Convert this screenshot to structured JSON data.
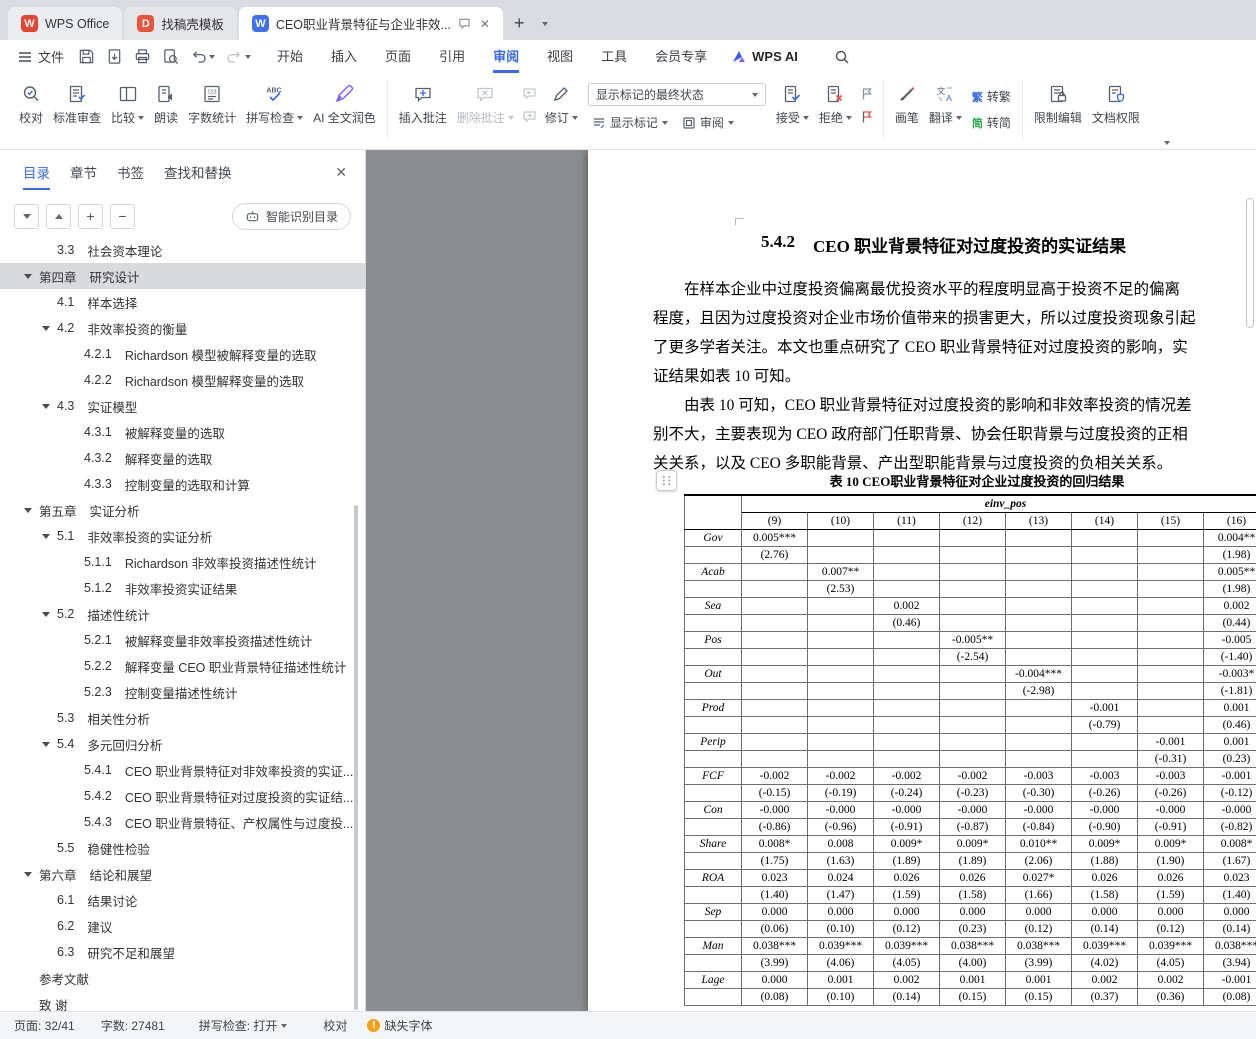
{
  "window": {
    "tabs": [
      {
        "title": "WPS Office"
      },
      {
        "title": "找稿壳模板"
      },
      {
        "title": "CEO职业背景特征与企业非效...",
        "active": true
      }
    ]
  },
  "menubar": {
    "file": "文件",
    "tabs": [
      "开始",
      "插入",
      "页面",
      "引用",
      "审阅",
      "视图",
      "工具",
      "会员专享"
    ],
    "active": "审阅",
    "wps_ai": "WPS AI"
  },
  "ribbon": {
    "proofread": "校对",
    "standard_review": "标准审查",
    "compare": "比较",
    "read_aloud": "朗读",
    "word_count": "字数统计",
    "spell_check": "拼写检查",
    "ai_polish": "AI 全文润色",
    "insert_comment": "插入批注",
    "delete_comment": "删除批注",
    "track_changes": "修订",
    "markup_state": "显示标记的最终状态",
    "show_markup": "显示标记",
    "review_mode": "审阅",
    "accept": "接受",
    "reject": "拒绝",
    "pen": "画笔",
    "translate": "翻译",
    "trad_char": "繁",
    "simp_char": "简",
    "to_trad": "转繁",
    "to_simp": "转简",
    "restrict_edit": "限制编辑",
    "doc_permission": "文档权限"
  },
  "sidebar": {
    "tabs": [
      "目录",
      "章节",
      "书签",
      "查找和替换"
    ],
    "active": "目录",
    "smart_toc": "智能识别目录",
    "toc": [
      {
        "num": "3.3",
        "title": "社会资本理论",
        "level": 2,
        "partial": true
      },
      {
        "num": "第四章",
        "title": "研究设计",
        "level": 1,
        "expand": true,
        "selected": true
      },
      {
        "num": "4.1",
        "title": "样本选择",
        "level": 2
      },
      {
        "num": "4.2",
        "title": "非效率投资的衡量",
        "level": 2,
        "expand": true
      },
      {
        "num": "4.2.1",
        "title": "Richardson 模型被解释变量的选取",
        "level": 3
      },
      {
        "num": "4.2.2",
        "title": "Richardson 模型解释变量的选取",
        "level": 3
      },
      {
        "num": "4.3",
        "title": "实证模型",
        "level": 2,
        "expand": true
      },
      {
        "num": "4.3.1",
        "title": "被解释变量的选取",
        "level": 3
      },
      {
        "num": "4.3.2",
        "title": "解释变量的选取",
        "level": 3
      },
      {
        "num": "4.3.3",
        "title": "控制变量的选取和计算",
        "level": 3
      },
      {
        "num": "第五章",
        "title": "实证分析",
        "level": 1,
        "expand": true
      },
      {
        "num": "5.1",
        "title": "非效率投资的实证分析",
        "level": 2,
        "expand": true
      },
      {
        "num": "5.1.1",
        "title": "Richardson 非效率投资描述性统计",
        "level": 3
      },
      {
        "num": "5.1.2",
        "title": "非效率投资实证结果",
        "level": 3
      },
      {
        "num": "5.2",
        "title": "描述性统计",
        "level": 2,
        "expand": true
      },
      {
        "num": "5.2.1",
        "title": "被解释变量非效率投资描述性统计",
        "level": 3
      },
      {
        "num": "5.2.2",
        "title": "解释变量 CEO 职业背景特征描述性统计",
        "level": 3
      },
      {
        "num": "5.2.3",
        "title": "控制变量描述性统计",
        "level": 3
      },
      {
        "num": "5.3",
        "title": "相关性分析",
        "level": 2
      },
      {
        "num": "5.4",
        "title": "多元回归分析",
        "level": 2,
        "expand": true
      },
      {
        "num": "5.4.1",
        "title": "CEO 职业背景特征对非效率投资的实证...",
        "level": 3
      },
      {
        "num": "5.4.2",
        "title": "CEO 职业背景特征对过度投资的实证结...",
        "level": 3
      },
      {
        "num": "5.4.3",
        "title": "CEO 职业背景特征、产权属性与过度投...",
        "level": 3
      },
      {
        "num": "5.5",
        "title": "稳健性检验",
        "level": 2
      },
      {
        "num": "第六章",
        "title": "结论和展望",
        "level": 1,
        "expand": true
      },
      {
        "num": "6.1",
        "title": "结果讨论",
        "level": 2
      },
      {
        "num": "6.2",
        "title": "建议",
        "level": 2
      },
      {
        "num": "6.3",
        "title": "研究不足和展望",
        "level": 2
      },
      {
        "num": "",
        "title": "参考文献",
        "level": 1
      },
      {
        "num": "",
        "title": "致 谢",
        "level": 1
      }
    ]
  },
  "document": {
    "heading_num": "5.4.2",
    "heading": "CEO 职业背景特征对过度投资的实证结果",
    "para1": [
      "在样本企业中过度投资偏离最优投资水平的程度明显高于投资不足的偏离",
      "程度，且因为过度投资对企业市场价值带来的损害更大，所以过度投资现象引起",
      "了更多学者关注。本文也重点研究了 CEO 职业背景特征对过度投资的影响，实",
      "证结果如表 10 可知。"
    ],
    "para2": [
      "由表 10 可知，CEO 职业背景特征对过度投资的影响和非效率投资的情况差",
      "别不大，主要表现为 CEO 政府部门任职背景、协会任职背景与过度投资的正相",
      "关关系，以及 CEO 多职能背景、产出型职能背景与过度投资的负相关关系。"
    ],
    "table": {
      "caption": "表 10  CEO职业背景特征对企业过度投资的回归结果",
      "group_header": "einv_pos",
      "col_headers": [
        "(9)",
        "(10)",
        "(11)",
        "(12)",
        "(13)",
        "(14)",
        "(15)",
        "(16)"
      ],
      "rows": [
        {
          "v": "Gov",
          "c": [
            "0.005***",
            "",
            "",
            "",
            "",
            "",
            "",
            "0.004**"
          ],
          "t": [
            "(2.76)",
            "",
            "",
            "",
            "",
            "",
            "",
            "(1.98)"
          ]
        },
        {
          "v": "Acab",
          "c": [
            "",
            "0.007**",
            "",
            "",
            "",
            "",
            "",
            "0.005**"
          ],
          "t": [
            "",
            "(2.53)",
            "",
            "",
            "",
            "",
            "",
            "(1.98)"
          ]
        },
        {
          "v": "Sea",
          "c": [
            "",
            "",
            "0.002",
            "",
            "",
            "",
            "",
            "0.002"
          ],
          "t": [
            "",
            "",
            "(0.46)",
            "",
            "",
            "",
            "",
            "(0.44)"
          ]
        },
        {
          "v": "Pos",
          "c": [
            "",
            "",
            "",
            "-0.005**",
            "",
            "",
            "",
            "-0.005"
          ],
          "t": [
            "",
            "",
            "",
            "(-2.54)",
            "",
            "",
            "",
            "(-1.40)"
          ]
        },
        {
          "v": "Out",
          "c": [
            "",
            "",
            "",
            "",
            "-0.004***",
            "",
            "",
            "-0.003*"
          ],
          "t": [
            "",
            "",
            "",
            "",
            "(-2.98)",
            "",
            "",
            "(-1.81)"
          ]
        },
        {
          "v": "Prod",
          "c": [
            "",
            "",
            "",
            "",
            "",
            "-0.001",
            "",
            "0.001"
          ],
          "t": [
            "",
            "",
            "",
            "",
            "",
            "(-0.79)",
            "",
            "(0.46)"
          ]
        },
        {
          "v": "Perip",
          "c": [
            "",
            "",
            "",
            "",
            "",
            "",
            "-0.001",
            "0.001"
          ],
          "t": [
            "",
            "",
            "",
            "",
            "",
            "",
            "(-0.31)",
            "(0.23)"
          ]
        },
        {
          "v": "FCF",
          "c": [
            "-0.002",
            "-0.002",
            "-0.002",
            "-0.002",
            "-0.003",
            "-0.003",
            "-0.003",
            "-0.001"
          ],
          "t": [
            "(-0.15)",
            "(-0.19)",
            "(-0.24)",
            "(-0.23)",
            "(-0.30)",
            "(-0.26)",
            "(-0.26)",
            "(-0.12)"
          ]
        },
        {
          "v": "Con",
          "c": [
            "-0.000",
            "-0.000",
            "-0.000",
            "-0.000",
            "-0.000",
            "-0.000",
            "-0.000",
            "-0.000"
          ],
          "t": [
            "(-0.86)",
            "(-0.96)",
            "(-0.91)",
            "(-0.87)",
            "(-0.84)",
            "(-0.90)",
            "(-0.91)",
            "(-0.82)"
          ]
        },
        {
          "v": "Share",
          "c": [
            "0.008*",
            "0.008",
            "0.009*",
            "0.009*",
            "0.010**",
            "0.009*",
            "0.009*",
            "0.008*"
          ],
          "t": [
            "(1.75)",
            "(1.63)",
            "(1.89)",
            "(1.89)",
            "(2.06)",
            "(1.88)",
            "(1.90)",
            "(1.67)"
          ]
        },
        {
          "v": "ROA",
          "c": [
            "0.023",
            "0.024",
            "0.026",
            "0.026",
            "0.027*",
            "0.026",
            "0.026",
            "0.023"
          ],
          "t": [
            "(1.40)",
            "(1.47)",
            "(1.59)",
            "(1.58)",
            "(1.66)",
            "(1.58)",
            "(1.59)",
            "(1.40)"
          ]
        },
        {
          "v": "Sep",
          "c": [
            "0.000",
            "0.000",
            "0.000",
            "0.000",
            "0.000",
            "0.000",
            "0.000",
            "0.000"
          ],
          "t": [
            "(0.06)",
            "(0.10)",
            "(0.12)",
            "(0.23)",
            "(0.12)",
            "(0.14)",
            "(0.12)",
            "(0.14)"
          ]
        },
        {
          "v": "Man",
          "c": [
            "0.038***",
            "0.039***",
            "0.039***",
            "0.038***",
            "0.038***",
            "0.039***",
            "0.039***",
            "0.038***"
          ],
          "t": [
            "(3.99)",
            "(4.06)",
            "(4.05)",
            "(4.00)",
            "(3.99)",
            "(4.02)",
            "(4.05)",
            "(3.94)"
          ]
        },
        {
          "v": "Lage",
          "c": [
            "0.000",
            "0.001",
            "0.002",
            "0.001",
            "0.001",
            "0.002",
            "0.002",
            "-0.001"
          ],
          "t": [
            "(0.08)",
            "(0.10)",
            "(0.14)",
            "(0.15)",
            "(0.15)",
            "(0.37)",
            "(0.36)",
            "(0.08)"
          ]
        }
      ]
    }
  },
  "statusbar": {
    "page": "页面: 32/41",
    "words": "字数: 27481",
    "spell": "拼写检查: 打开",
    "proof": "校对",
    "missing_font": "缺失字体"
  }
}
